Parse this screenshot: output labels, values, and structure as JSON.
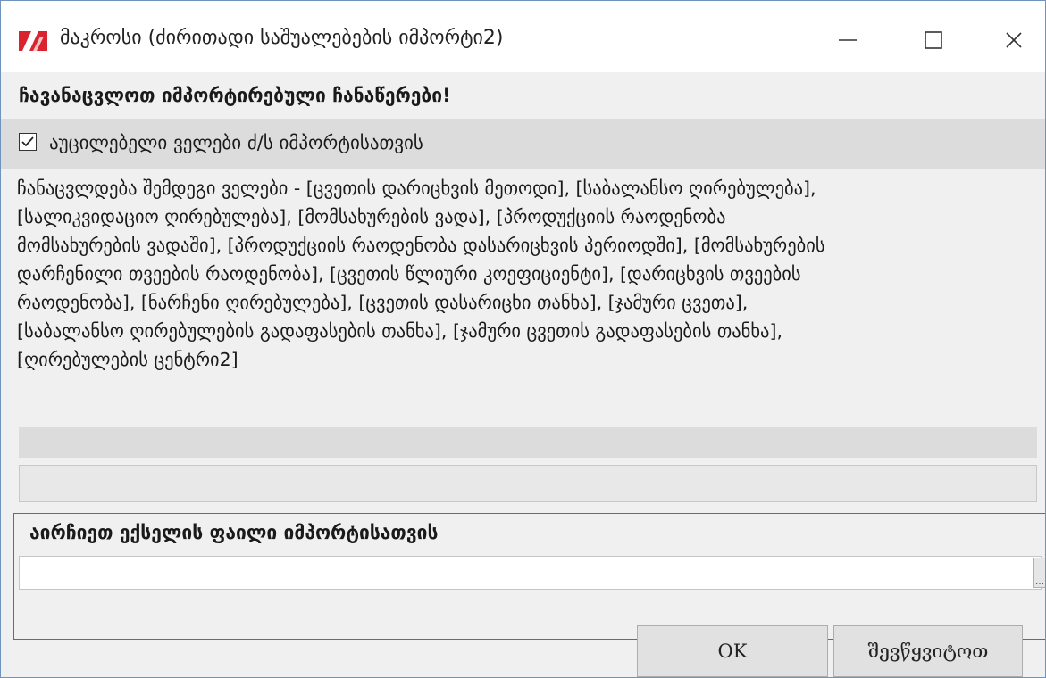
{
  "window": {
    "title": "მაკროსი (ძირითადი საშუალებების იმპორტი2)"
  },
  "header": {
    "text": "ჩავანაცვლოთ იმპორტირებული ჩანაწერები!"
  },
  "required_fields": {
    "checked": true,
    "label": "აუცილებელი ველები ძ/ს იმპორტისათვის"
  },
  "description": {
    "lines": [
      "ჩანაცვლდება შემდეგი ველები - [ცვეთის დარიცხვის მეთოდი], [საბალანსო ღირებულება],",
      "[სალიკვიდაციო ღირებულება], [მომსახურების ვადა], [პროდუქციის რაოდენობა",
      "მომსახურების ვადაში], [პროდუქციის რაოდენობა დასარიცხვის პერიოდში], [მომსახურების",
      "დარჩენილი თვეების რაოდენობა], [ცვეთის წლიური კოეფიციენტი], [დარიცხვის თვეების",
      "რაოდენობა], [ნარჩენი ღირებულება], [ცვეთის დასარიცხი თანხა], [ჯამური ცვეთა],",
      "[საბალანსო ღირებულების გადაფასების თანხა], [ჯამური ცვეთის გადაფასების თანხა],",
      "[ღირებულების ცენტრი2]"
    ]
  },
  "file_select": {
    "label": "აირჩიეთ ექსელის ფაილი იმპორტისათვის",
    "value": ""
  },
  "buttons": {
    "ok": "OK",
    "cancel": "შევწყვიტოთ"
  },
  "colors": {
    "accent_border": "#d04040",
    "window_border": "#6f93bd",
    "icon_red": "#d9232e"
  }
}
